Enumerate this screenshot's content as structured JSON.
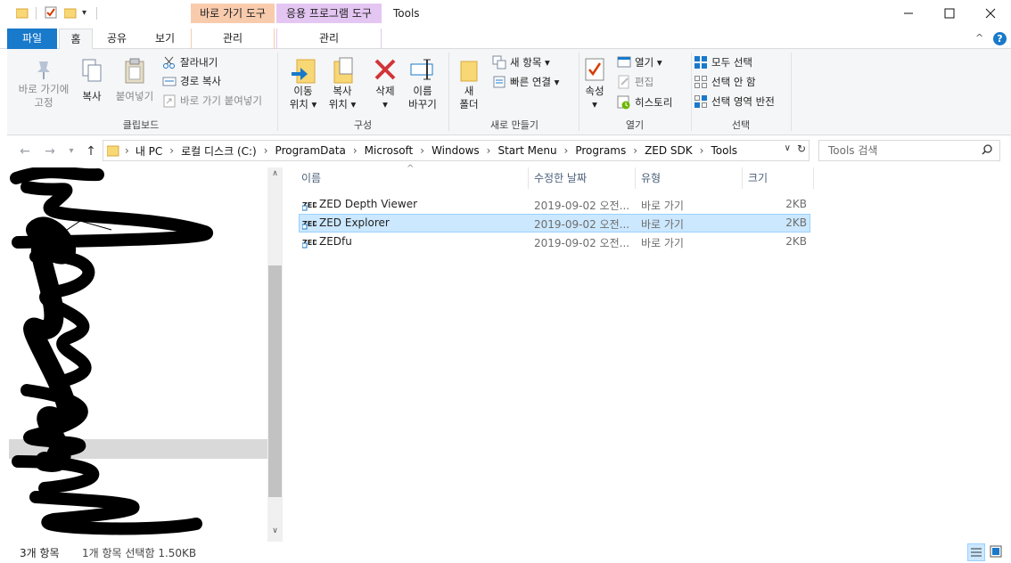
{
  "window": {
    "title": "Tools",
    "context_tabs": [
      {
        "group": "바로 가기 도구",
        "tab": "관리"
      },
      {
        "group": "응용 프로그램 도구",
        "tab": "관리"
      }
    ],
    "controls": {
      "minimize": "—",
      "maximize": "☐",
      "close": "✕"
    }
  },
  "tabs": {
    "file": "파일",
    "home": "홈",
    "share": "공유",
    "view": "보기"
  },
  "ribbon": {
    "clipboard": {
      "pin": "바로 가기에\n고정",
      "copy": "복사",
      "paste": "붙여넣기",
      "cut": "잘라내기",
      "copy_path": "경로 복사",
      "paste_shortcut": "바로 가기 붙여넣기",
      "label": "클립보드"
    },
    "organize": {
      "move_to": "이동\n위치 ▾",
      "copy_to": "복사\n위치 ▾",
      "delete": "삭제\n▾",
      "rename": "이름\n바꾸기",
      "label": "구성"
    },
    "new": {
      "new_folder": "새\n폴더",
      "new_item": "새 항목 ▾",
      "easy_access": "빠른 연결 ▾",
      "label": "새로 만들기"
    },
    "open": {
      "properties": "속성\n▾",
      "open": "열기 ▾",
      "edit": "편집",
      "history": "히스토리",
      "label": "열기"
    },
    "select": {
      "select_all": "모두 선택",
      "select_none": "선택 안 함",
      "invert": "선택 영역 반전",
      "label": "선택"
    }
  },
  "address": {
    "crumbs": [
      "내 PC",
      "로컬 디스크 (C:)",
      "ProgramData",
      "Microsoft",
      "Windows",
      "Start Menu",
      "Programs",
      "ZED SDK",
      "Tools"
    ],
    "search_placeholder": "Tools 검색"
  },
  "columns": {
    "name": "이름",
    "modified": "수정한 날짜",
    "type": "유형",
    "size": "크기"
  },
  "files": [
    {
      "name": "ZED Depth Viewer",
      "modified": "2019-09-02 오전...",
      "type": "바로 가기",
      "size": "2KB"
    },
    {
      "name": "ZED Explorer",
      "modified": "2019-09-02 오전...",
      "type": "바로 가기",
      "size": "2KB"
    },
    {
      "name": "ZEDfu",
      "modified": "2019-09-02 오전...",
      "type": "바로 가기",
      "size": "2KB"
    }
  ],
  "status": {
    "count": "3개 항목",
    "selection": "1개 항목 선택함 1.50KB"
  },
  "colors": {
    "accent": "#1979ca",
    "selection": "#cce8ff",
    "shortcut_tools": "#f8cbad",
    "app_tools": "#e4c6f2"
  }
}
